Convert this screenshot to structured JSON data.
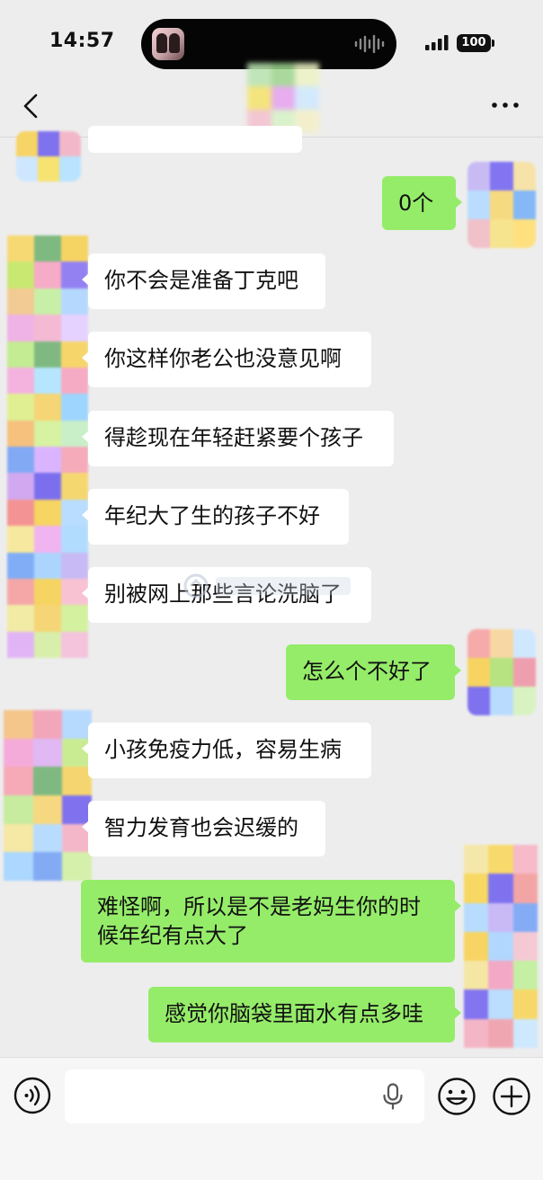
{
  "status_bar": {
    "time": "14:57",
    "battery": "100",
    "icons": [
      "app-thumbnail-icon",
      "audio-wave-icon",
      "signal-icon",
      "battery-icon"
    ]
  },
  "nav": {
    "icons": [
      "back-arrow-icon",
      "more-dots-icon"
    ]
  },
  "messages": [
    {
      "id": "m0",
      "side": "in",
      "text": ""
    },
    {
      "id": "m1",
      "side": "out",
      "text": "0个"
    },
    {
      "id": "m2",
      "side": "in",
      "text": "你不会是准备丁克吧"
    },
    {
      "id": "m3",
      "side": "in",
      "text": "你这样你老公也没意见啊"
    },
    {
      "id": "m4",
      "side": "in",
      "text": "得趁现在年轻赶紧要个孩子"
    },
    {
      "id": "m5",
      "side": "in",
      "text": "年纪大了生的孩子不好"
    },
    {
      "id": "m6",
      "side": "in",
      "text": "别被网上那些言论洗脑了"
    },
    {
      "id": "m7",
      "side": "out",
      "text": "怎么个不好了"
    },
    {
      "id": "m8",
      "side": "in",
      "text": "小孩免疫力低，容易生病"
    },
    {
      "id": "m9",
      "side": "in",
      "text": "智力发育也会迟缓的"
    },
    {
      "id": "m10",
      "side": "out",
      "text": "难怪啊，所以是不是老妈生你的时候年纪有点大了"
    },
    {
      "id": "m11",
      "side": "out",
      "text": "感觉你脑袋里面水有点多哇"
    }
  ],
  "input_bar": {
    "value": "",
    "icons": [
      "voice-icon",
      "microphone-icon",
      "emoji-icon",
      "plus-icon"
    ]
  },
  "colors": {
    "background": "#ededed",
    "incoming_bubble": "#ffffff",
    "outgoing_bubble": "#95ec69",
    "input_bar": "#f6f6f6"
  }
}
